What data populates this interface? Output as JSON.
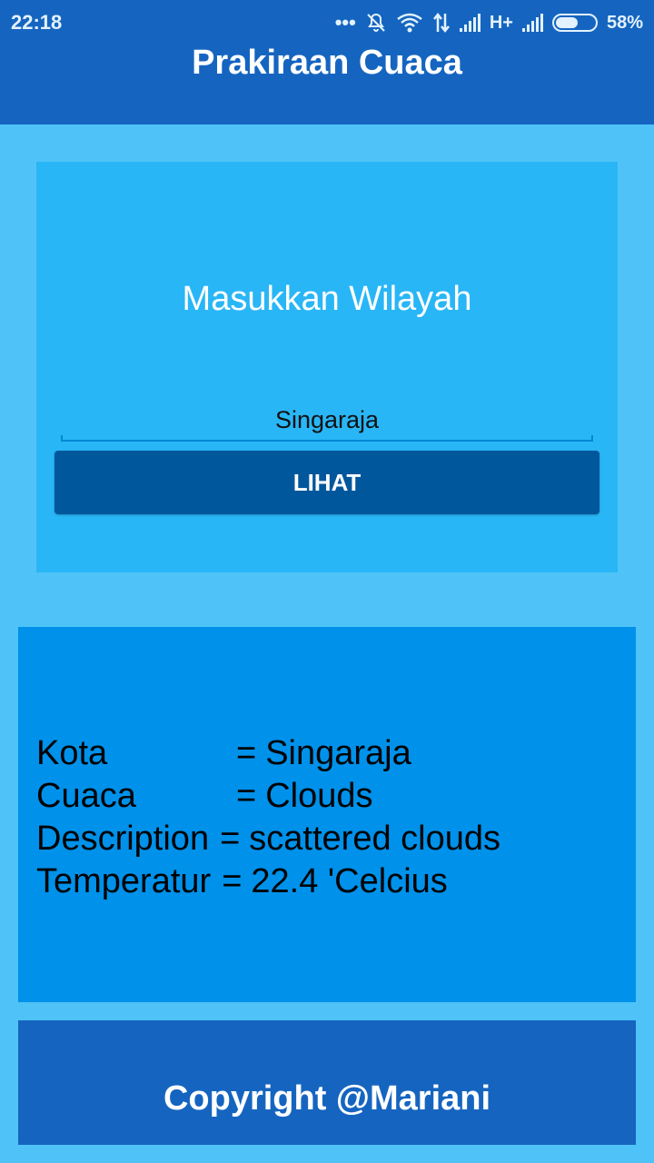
{
  "status_bar": {
    "time": "22:18",
    "network_type": "H+",
    "battery_percent": "58%"
  },
  "app_bar": {
    "title": "Prakiraan Cuaca"
  },
  "search_card": {
    "heading": "Masukkan Wilayah",
    "city_input_value": "Singaraja",
    "button_label": "LIHAT"
  },
  "result_card": {
    "rows": [
      {
        "label": "Kota",
        "separator": "=",
        "value": "Singaraja"
      },
      {
        "label": "Cuaca",
        "separator": "=",
        "value": "Clouds"
      },
      {
        "label": "Description",
        "separator": "=",
        "value": "scattered clouds"
      },
      {
        "label": "Temperatur",
        "separator": "=",
        "value": "22.4 'Celcius"
      }
    ]
  },
  "footer": {
    "text": "Copyright @Mariani"
  },
  "colors": {
    "background": "#4fc3f7",
    "app_bar": "#1565c0",
    "search_card": "#29b6f6",
    "button": "#01579b",
    "result_card": "#0091ea"
  }
}
